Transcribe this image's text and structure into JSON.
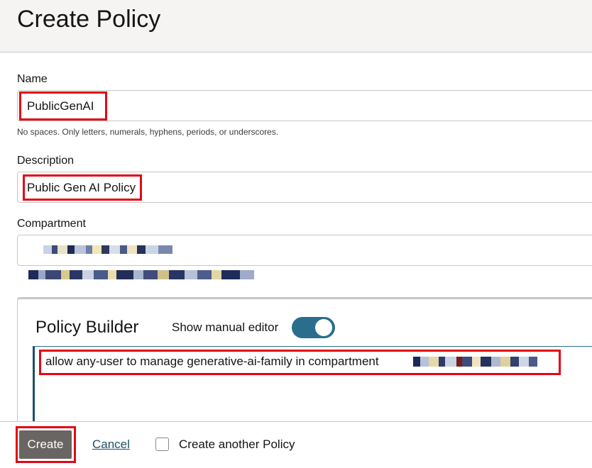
{
  "page": {
    "title": "Create Policy"
  },
  "form": {
    "name": {
      "label": "Name",
      "value": "PublicGenAI",
      "hint": "No spaces. Only letters, numerals, hyphens, periods, or underscores."
    },
    "description": {
      "label": "Description",
      "value": "Public Gen AI Policy"
    },
    "compartment": {
      "label": "Compartment",
      "value_obscured": true,
      "path_obscured": true
    }
  },
  "policy_builder": {
    "title": "Policy Builder",
    "toggle_label": "Show manual editor",
    "toggle_on": true,
    "statement": "allow any-user to manage generative-ai-family in compartment",
    "statement_suffix_obscured": true
  },
  "footer": {
    "create_label": "Create",
    "cancel_label": "Cancel",
    "create_another_label": "Create another Policy",
    "create_another_checked": false
  },
  "colors": {
    "highlight_box": "#e30613",
    "toggle_on": "#2a6e8c",
    "primary_button": "#686562",
    "link": "#1c4f67"
  }
}
